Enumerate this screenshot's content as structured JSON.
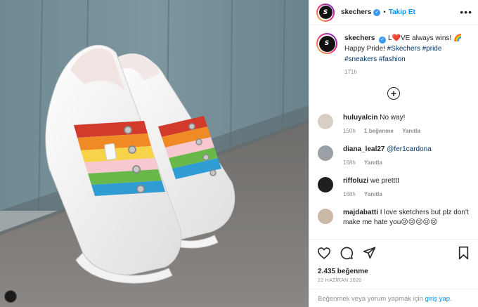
{
  "post": {
    "username": "skechers",
    "follow_label": "Takip Et",
    "more_label": "•••",
    "caption": {
      "user": "skechers",
      "pre_heart": "L",
      "heart": "❤️",
      "post_heart": "VE always wins! 🌈",
      "line2": "Happy Pride!",
      "tags": [
        "#Skechers",
        "#pride",
        "#sneakers",
        "#fashion"
      ],
      "time": "171h"
    },
    "load_more": "+",
    "comments": [
      {
        "user": "huluyalcin",
        "text": "No way!",
        "time": "150h",
        "likes": "1 beğenme",
        "reply": "Yanıtla",
        "avatar_color": "#d8cfc4"
      },
      {
        "user": "diana_leal27",
        "text": "@fer1cardona",
        "time": "168h",
        "reply": "Yanıtla",
        "avatar_color": "#9aa0a6"
      },
      {
        "user": "riffoluzi",
        "text": "we pretttt",
        "time": "168h",
        "reply": "Yanıtla",
        "avatar_color": "#1f1f1f"
      },
      {
        "user": "majdabatti",
        "text": "I love sketchers but plz don't make me hate you😢😢😢😢😢",
        "avatar_color": "#c9b8a6"
      }
    ],
    "likes": "2.435 beğenme",
    "date": "22 HAZİRAN 2020",
    "login_prefix": "Beğenmek veya yorum yapmak için",
    "login_link": "giriş yap",
    "login_suffix": "."
  },
  "logo_text": "S",
  "colors": {
    "accent": "#0095f6",
    "heart": "#d91f2a",
    "tag": "#00376b"
  },
  "icons": [
    "heart-icon",
    "comment-icon",
    "share-icon",
    "bookmark-icon",
    "plus-circle-icon",
    "verified-icon"
  ]
}
